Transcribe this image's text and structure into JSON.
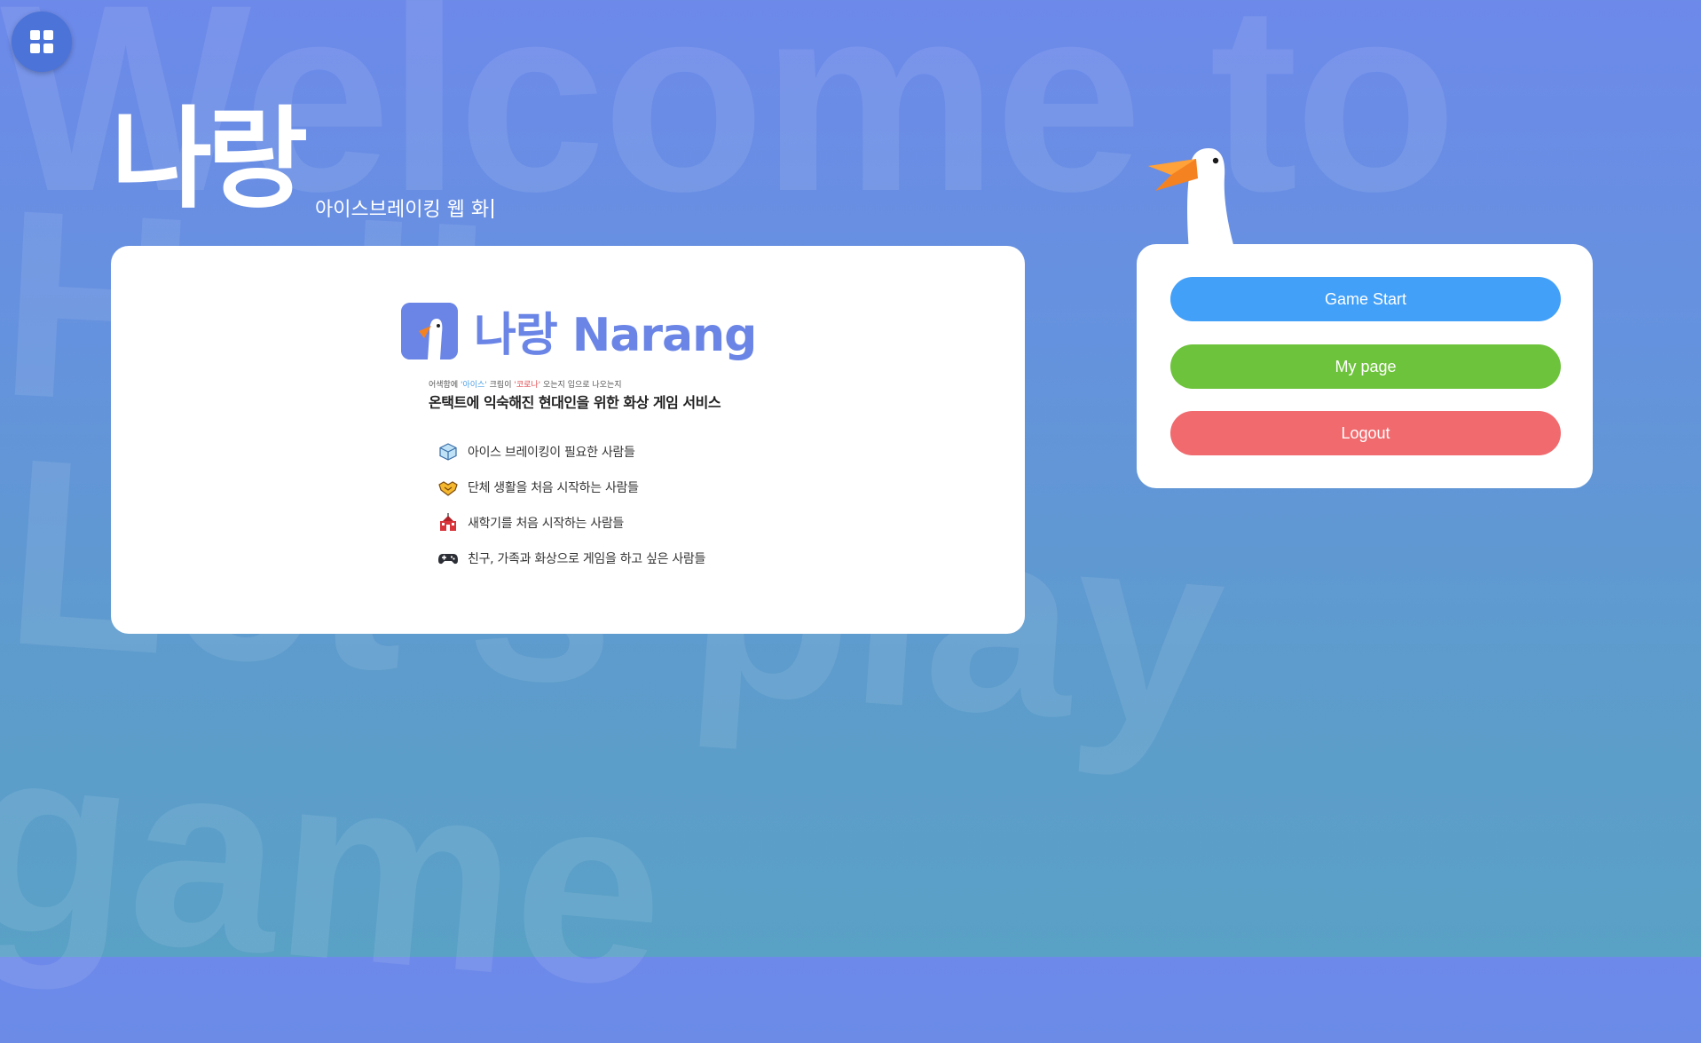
{
  "background_words": [
    "Welcome to",
    "Hello",
    "Let's play",
    "game"
  ],
  "menu": {
    "icon": "grid-menu-icon",
    "color": "#4b73d8"
  },
  "brand": {
    "logo_text": "나랑",
    "tagline": "아이스브레이킹 웹 화"
  },
  "info_card": {
    "app_title": "나랑 Narang",
    "subnote_parts": [
      "어색함에 ",
      "'아이스'",
      " 크림이 ",
      "'코로나'",
      " 오는지 입으로 나오는지"
    ],
    "headline": "온택트에 익숙해진 현대인을 위한 화상 게임 서비스",
    "features": [
      {
        "icon": "ice-cube-icon",
        "text": "아이스 브레이킹이 필요한 사람들"
      },
      {
        "icon": "handshake-icon",
        "text": "단체 생활을 처음 시작하는 사람들"
      },
      {
        "icon": "school-icon",
        "text": "새학기를 처음 시작하는 사람들"
      },
      {
        "icon": "gamepad-icon",
        "text": "친구, 가족과 화상으로 게임을 하고 싶은 사람들"
      }
    ]
  },
  "actions": {
    "game_start": {
      "label": "Game Start",
      "color": "#42a0f8"
    },
    "my_page": {
      "label": "My page",
      "color": "#6dc33b"
    },
    "logout": {
      "label": "Logout",
      "color": "#f06a6e"
    }
  },
  "colors": {
    "accent": "#6a85e6",
    "background_top": "#6d89ea",
    "background_bottom": "#5aa1c6"
  }
}
